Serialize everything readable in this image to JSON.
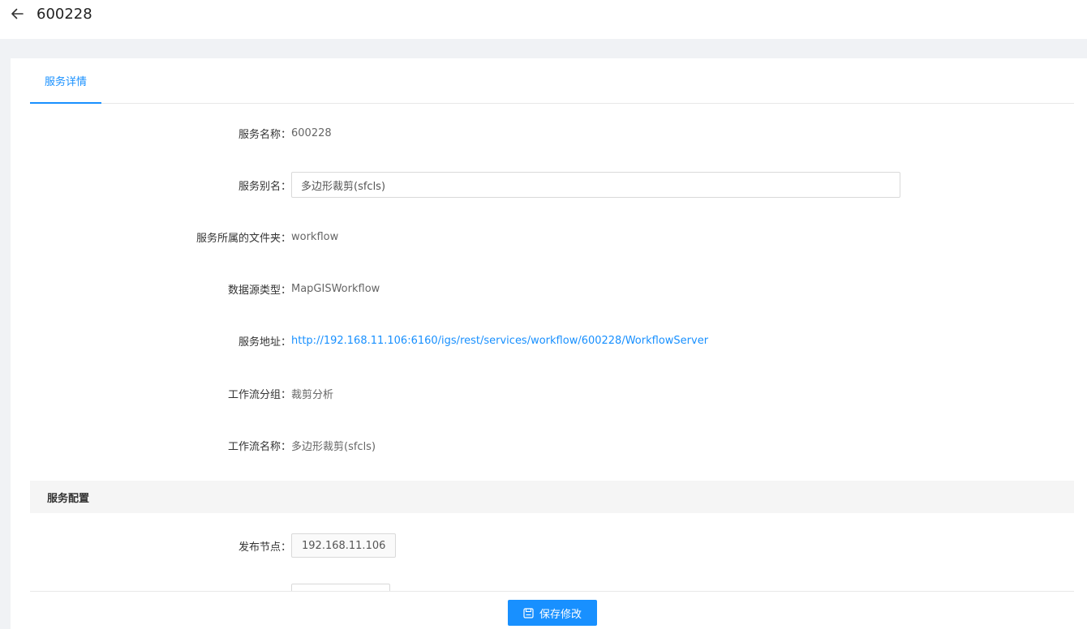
{
  "header": {
    "back_icon": "arrow-left-icon",
    "title": "600228"
  },
  "tabs": [
    {
      "label": "服务详情",
      "active": true
    }
  ],
  "details": {
    "service_name": {
      "label": "服务名称：",
      "value": "600228"
    },
    "service_alias": {
      "label": "服务别名：",
      "value": "多边形裁剪(sfcls)"
    },
    "service_folder": {
      "label": "服务所属的文件夹：",
      "value": "workflow"
    },
    "datasource_type": {
      "label": "数据源类型：",
      "value": "MapGISWorkflow"
    },
    "service_address": {
      "label": "服务地址：",
      "value": "http://192.168.11.106:6160/igs/rest/services/workflow/600228/WorkflowServer"
    },
    "workflow_group": {
      "label": "工作流分组：",
      "value": "裁剪分析"
    },
    "workflow_name": {
      "label": "工作流名称：",
      "value": "多边形裁剪(sfcls)"
    }
  },
  "config": {
    "section_title": "服务配置",
    "publish_node": {
      "label": "发布节点：",
      "value": "192.168.11.106"
    }
  },
  "footer": {
    "save_icon": "save-icon",
    "save_label": "保存修改"
  },
  "colors": {
    "accent": "#1890ff",
    "background": "#f0f2f5",
    "section_bg": "#f5f5f5"
  }
}
